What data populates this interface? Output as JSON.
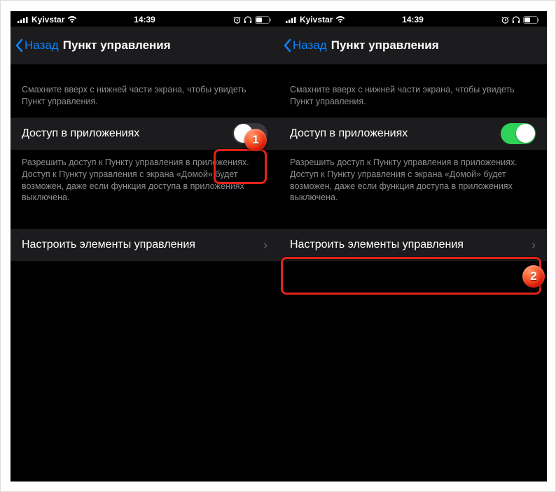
{
  "status": {
    "carrier": "Kyivstar",
    "time": "14:39"
  },
  "nav": {
    "back": "Назад",
    "title": "Пункт управления"
  },
  "body": {
    "hint": "Смахните вверх с нижней части экрана, чтобы увидеть Пункт управления.",
    "access_label": "Доступ в приложениях",
    "access_footer": "Разрешить доступ к Пункту управления в приложениях. Доступ к Пункту управления с экрана «Домой» будет возможен, даже если функция доступа в приложениях выключена.",
    "customize_label": "Настроить элементы управления"
  },
  "markers": {
    "one": "1",
    "two": "2"
  },
  "toggle_state": {
    "left_panel": "off",
    "right_panel": "on"
  }
}
